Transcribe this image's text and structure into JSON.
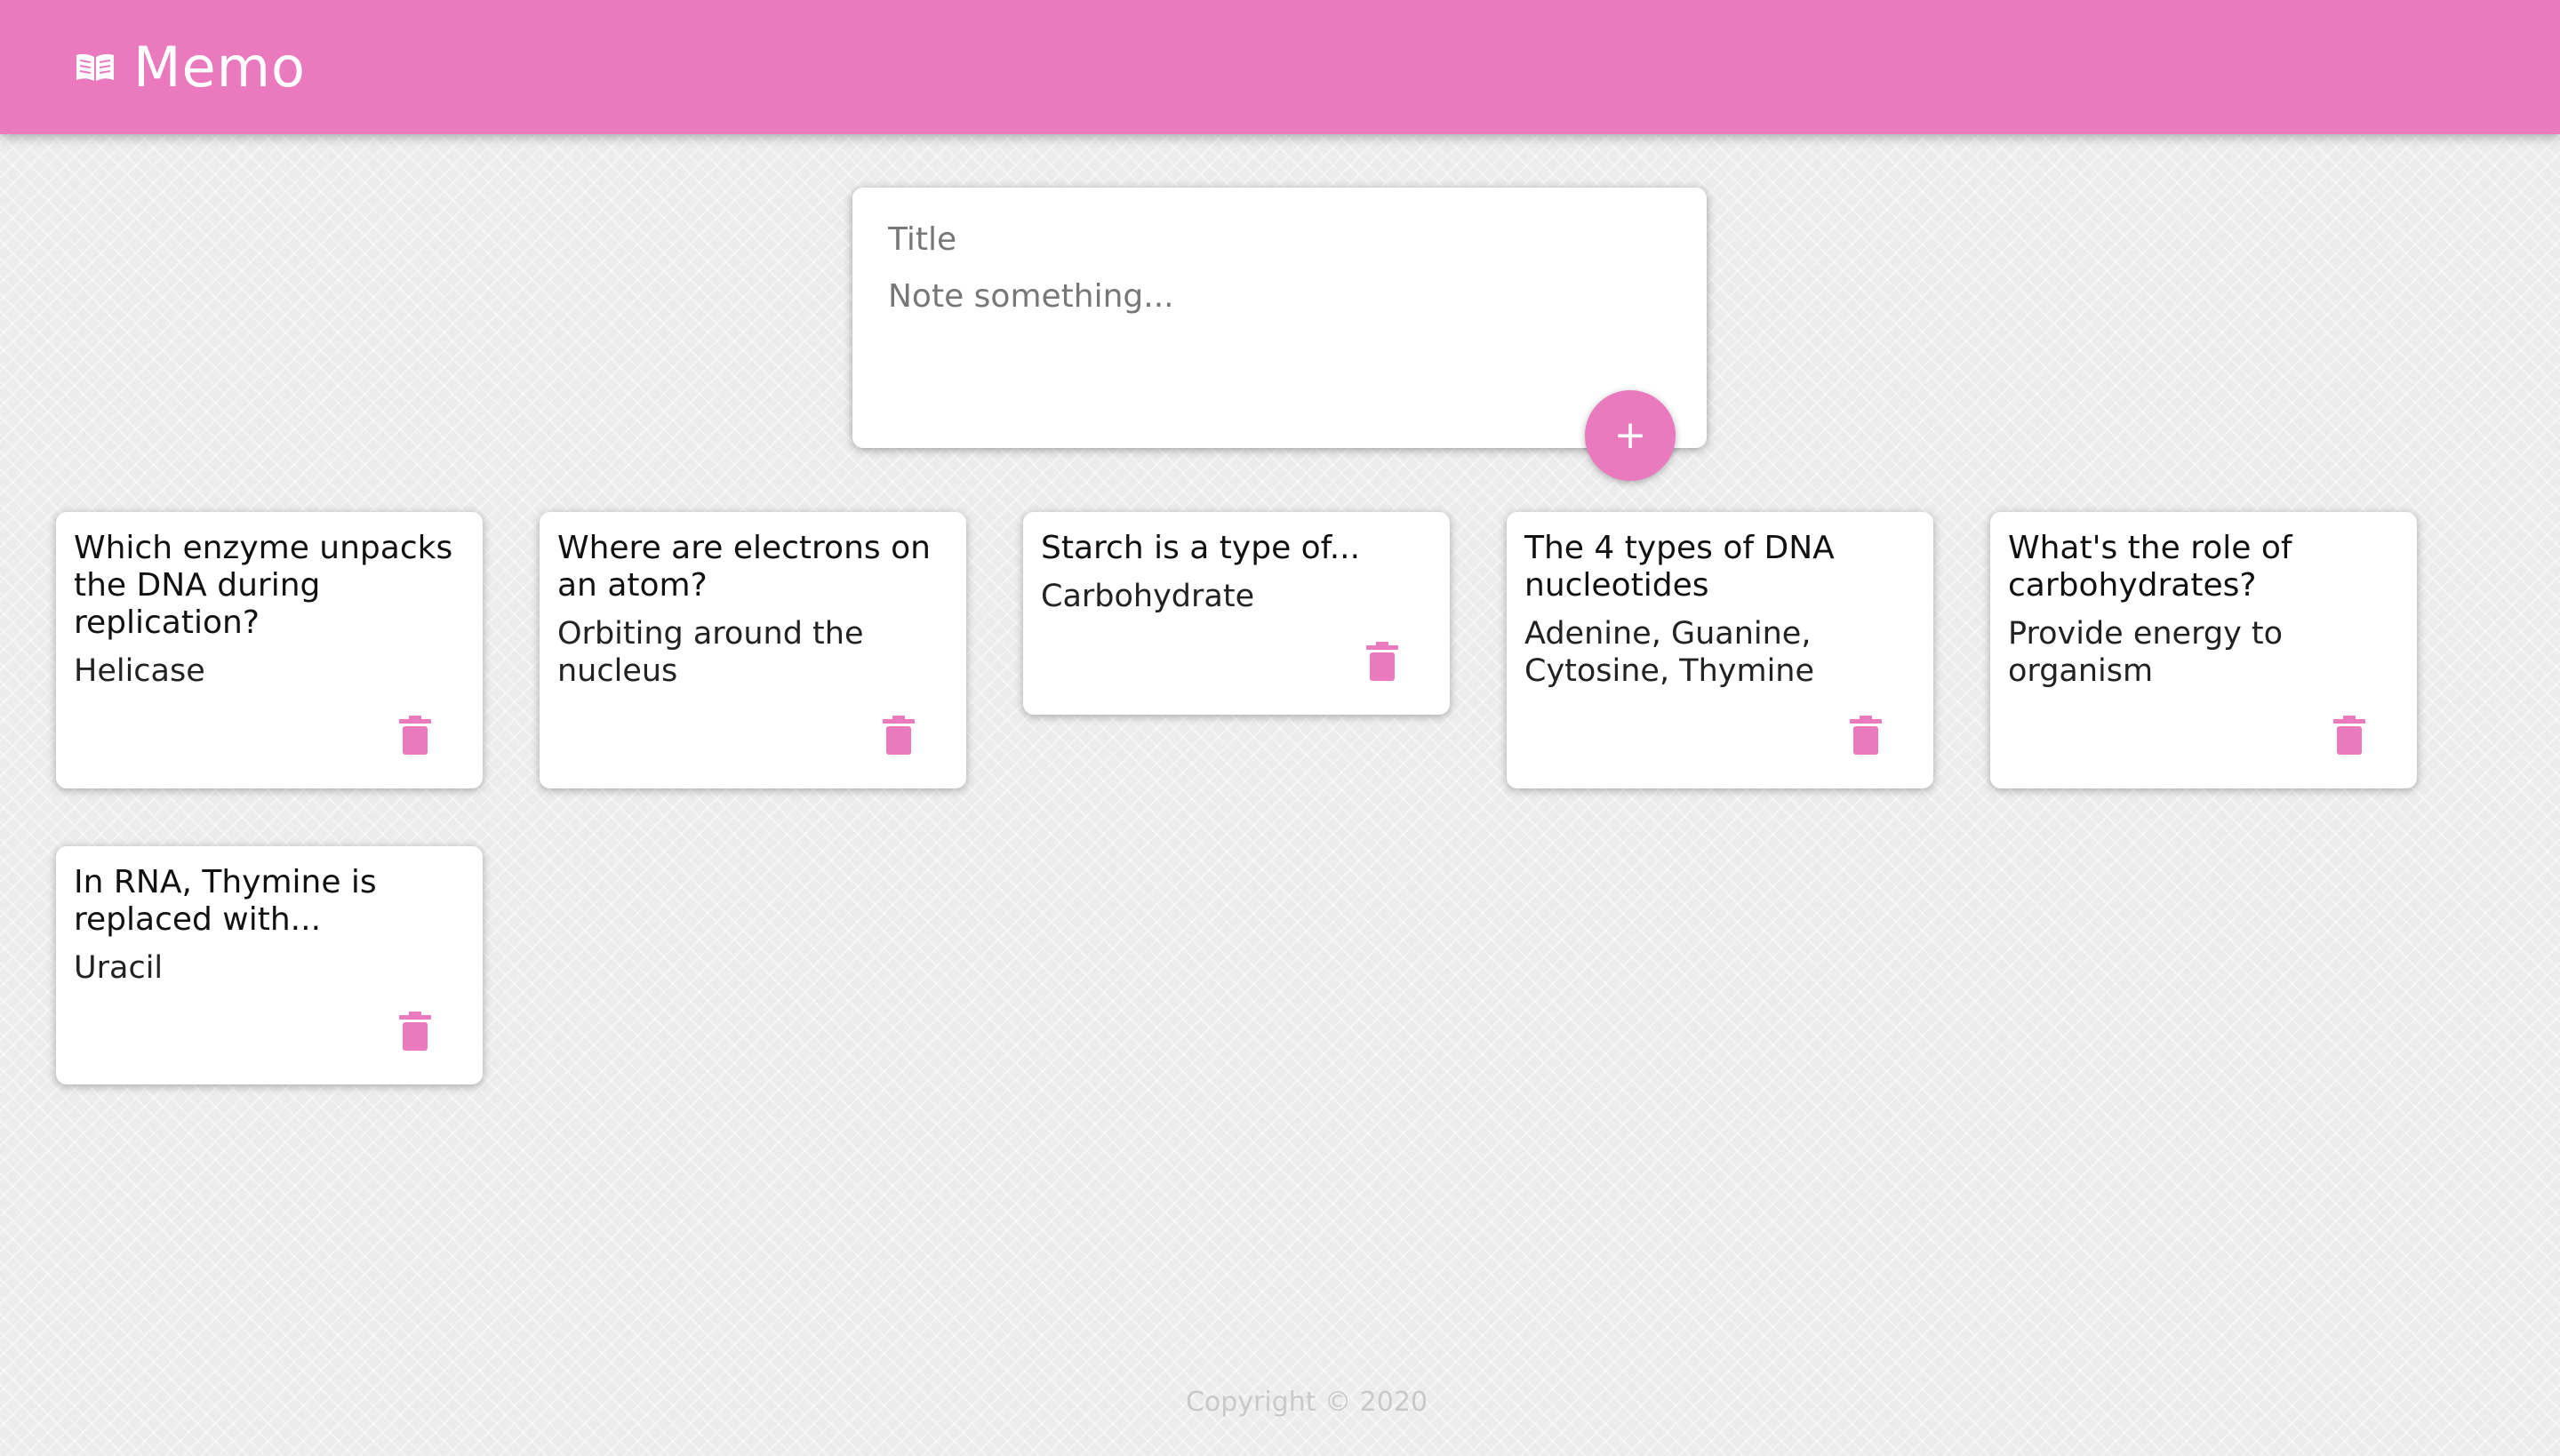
{
  "header": {
    "title": "Memo",
    "icon": "book-open-icon",
    "background_color": "#ea79bd"
  },
  "composer": {
    "title_placeholder": "Title",
    "content_placeholder": "Note something...",
    "add_button_icon": "plus-icon",
    "add_button_glyph": "+"
  },
  "notes": [
    {
      "title": "Which enzyme unpacks the DNA during replication?",
      "content": "Helicase"
    },
    {
      "title": "Where are electrons on an atom?",
      "content": "Orbiting around the nucleus"
    },
    {
      "title": "Starch is a type of...",
      "content": "Carbohydrate"
    },
    {
      "title": "The 4 types of DNA nucleotides",
      "content": "Adenine, Guanine, Cytosine, Thymine"
    },
    {
      "title": "What's the role of carbohydrates?",
      "content": "Provide energy  to organism"
    },
    {
      "title": "In RNA, Thymine is replaced with...",
      "content": "Uracil"
    }
  ],
  "footer": {
    "text": "Copyright © 2020"
  },
  "colors": {
    "accent": "#ea79bd",
    "background": "#ececec",
    "card": "#ffffff"
  }
}
